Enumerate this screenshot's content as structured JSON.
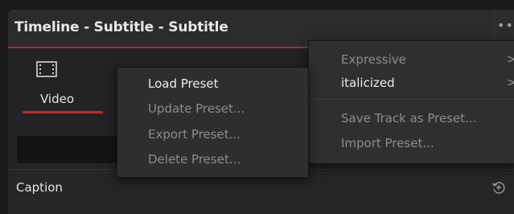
{
  "window": {
    "title": "Timeline - Subtitle - Subtitle",
    "more_icon": "more-dots-icon"
  },
  "tabs": [
    {
      "label": "Video",
      "icon": "filmstrip-icon",
      "active": true
    }
  ],
  "section": {
    "label": "Caption",
    "reset_icon": "reset-icon"
  },
  "preset_menu": {
    "items": [
      {
        "label": "Load Preset",
        "enabled": true
      },
      {
        "label": "Update Preset...",
        "enabled": false
      },
      {
        "label": "Export Preset...",
        "enabled": false
      },
      {
        "label": "Delete Preset...",
        "enabled": false
      }
    ]
  },
  "submenu": {
    "presets": [
      {
        "label": "Expressive",
        "enabled": false,
        "has_submenu": true
      },
      {
        "label": "italicized",
        "enabled": true,
        "has_submenu": true
      }
    ],
    "actions": [
      {
        "label": "Save Track as Preset...",
        "enabled": false
      },
      {
        "label": "Import Preset...",
        "enabled": false
      }
    ],
    "chevron_icon": "chevron-right-icon"
  },
  "colors": {
    "accent": "#c8282e",
    "panel": "#242426",
    "menu": "#2f2f31"
  }
}
